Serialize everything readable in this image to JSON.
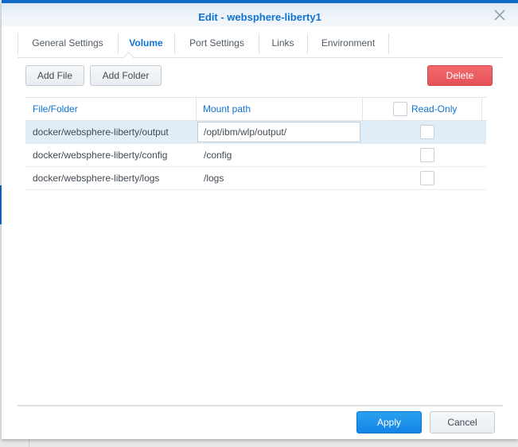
{
  "dialog": {
    "title": "Edit - websphere-liberty1",
    "close_icon": "close-x-icon"
  },
  "tabs": [
    {
      "label": "General Settings",
      "active": false
    },
    {
      "label": "Volume",
      "active": true
    },
    {
      "label": "Port Settings",
      "active": false
    },
    {
      "label": "Links",
      "active": false
    },
    {
      "label": "Environment",
      "active": false
    }
  ],
  "toolbar": {
    "add_file_label": "Add File",
    "add_folder_label": "Add Folder",
    "delete_label": "Delete"
  },
  "table": {
    "columns": {
      "file_folder": "File/Folder",
      "mount_path": "Mount path",
      "read_only": "Read-Only"
    },
    "read_only_all_checked": false,
    "rows": [
      {
        "file_folder": "docker/websphere-liberty/output",
        "mount_path": "/opt/ibm/wlp/output/",
        "read_only": false,
        "selected": true,
        "editing": true
      },
      {
        "file_folder": "docker/websphere-liberty/config",
        "mount_path": "/config",
        "read_only": false,
        "selected": false,
        "editing": false
      },
      {
        "file_folder": "docker/websphere-liberty/logs",
        "mount_path": "/logs",
        "read_only": false,
        "selected": false,
        "editing": false
      }
    ]
  },
  "footer": {
    "apply_label": "Apply",
    "cancel_label": "Cancel"
  },
  "colors": {
    "accent": "#0e72d2",
    "danger": "#e55257",
    "primary_button": "#1183e6",
    "selected_row": "#deedf8"
  }
}
